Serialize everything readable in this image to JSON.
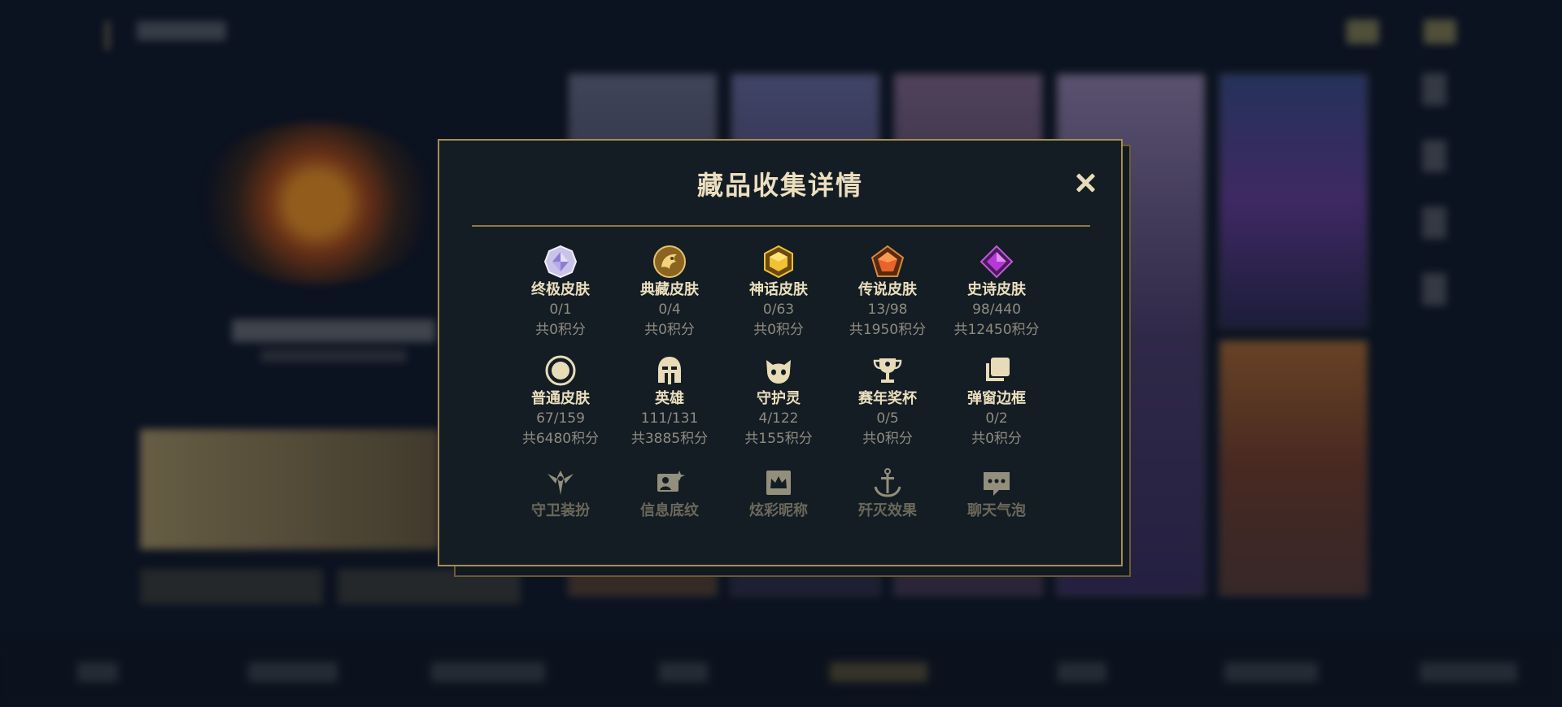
{
  "modal": {
    "title": "藏品收集详情",
    "close_icon": "close-icon",
    "categories": [
      {
        "label": "终极皮肤",
        "count": "0/1",
        "points": "共0积分",
        "icon": "ultimate-gem-icon"
      },
      {
        "label": "典藏皮肤",
        "count": "0/4",
        "points": "共0积分",
        "icon": "prestige-dragon-icon"
      },
      {
        "label": "神话皮肤",
        "count": "0/63",
        "points": "共0积分",
        "icon": "mythic-gem-icon"
      },
      {
        "label": "传说皮肤",
        "count": "13/98",
        "points": "共1950积分",
        "icon": "legendary-gem-icon"
      },
      {
        "label": "史诗皮肤",
        "count": "98/440",
        "points": "共12450积分",
        "icon": "epic-gem-icon"
      },
      {
        "label": "普通皮肤",
        "count": "67/159",
        "points": "共6480积分",
        "icon": "standard-ring-icon"
      },
      {
        "label": "英雄",
        "count": "111/131",
        "points": "共3885积分",
        "icon": "helmet-icon"
      },
      {
        "label": "守护灵",
        "count": "4/122",
        "points": "共155积分",
        "icon": "companion-icon"
      },
      {
        "label": "赛年奖杯",
        "count": "0/5",
        "points": "共0积分",
        "icon": "trophy-icon"
      },
      {
        "label": "弹窗边框",
        "count": "0/2",
        "points": "共0积分",
        "icon": "frame-icon"
      },
      {
        "label": "守卫装扮",
        "icon": "ward-icon"
      },
      {
        "label": "信息底纹",
        "icon": "profile-banner-icon"
      },
      {
        "label": "炫彩昵称",
        "icon": "crown-card-icon"
      },
      {
        "label": "歼灭效果",
        "icon": "sword-icon"
      },
      {
        "label": "聊天气泡",
        "icon": "chat-bubble-icon"
      }
    ]
  },
  "colors": {
    "accent_gold": "#a88e55",
    "title": "#ecdfbf",
    "muted": "#8f8b80",
    "modal_bg": "#141d24"
  }
}
